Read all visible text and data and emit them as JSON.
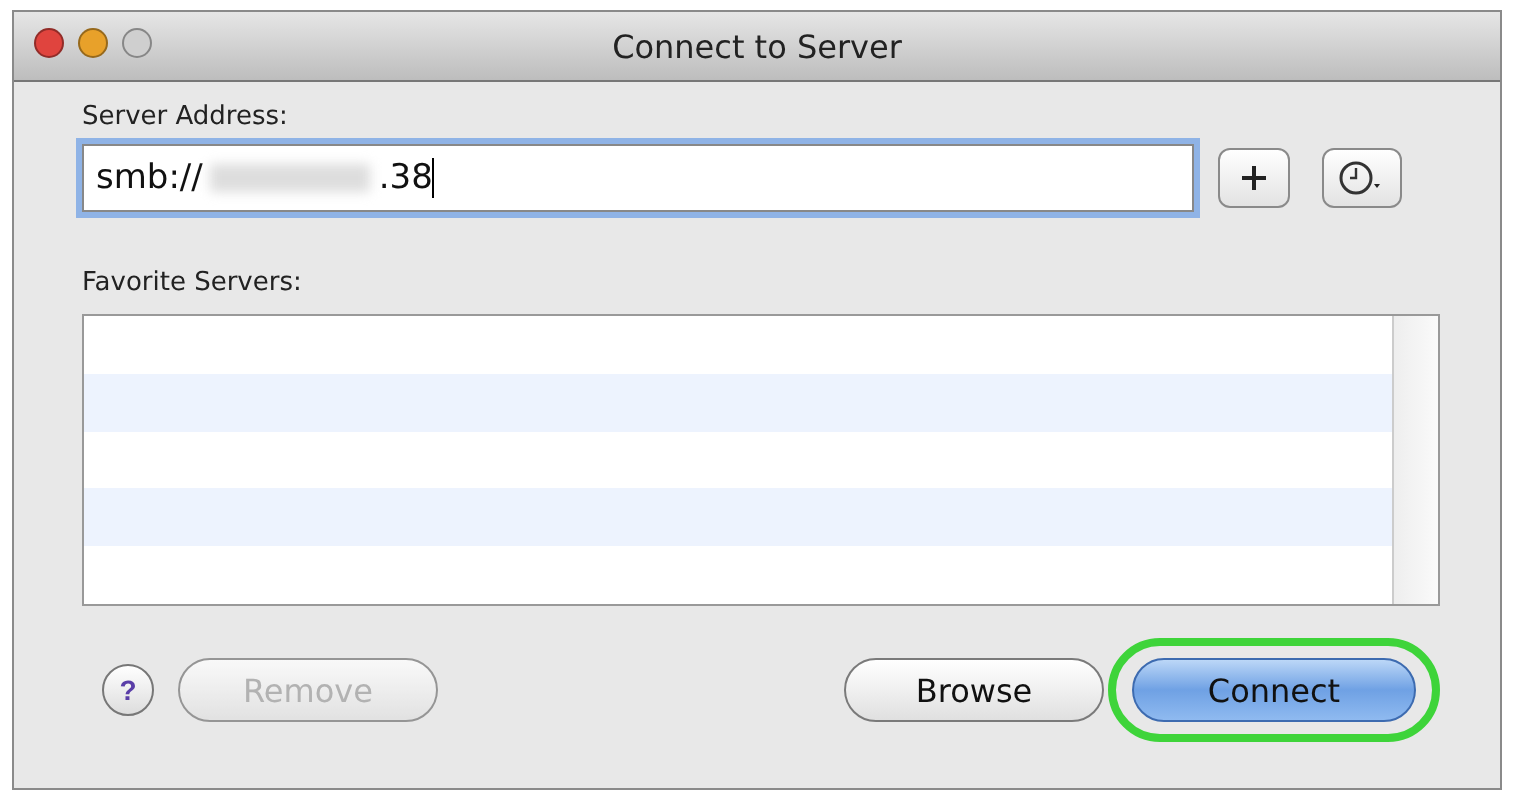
{
  "window": {
    "title": "Connect to Server"
  },
  "server_address": {
    "label": "Server Address:",
    "value_prefix": "smb://",
    "value_suffix": ".38",
    "focused": true
  },
  "favorites": {
    "label": "Favorite Servers:"
  },
  "buttons": [
    {
      "kind": "help",
      "label": "?"
    },
    {
      "kind": "push",
      "label": "Remove",
      "disabled": true,
      "default": false,
      "highlighted": false
    },
    {
      "kind": "push",
      "label": "Browse",
      "disabled": false,
      "default": false,
      "highlighted": false
    },
    {
      "kind": "push",
      "label": "Connect",
      "disabled": false,
      "default": true,
      "highlighted": true
    }
  ]
}
